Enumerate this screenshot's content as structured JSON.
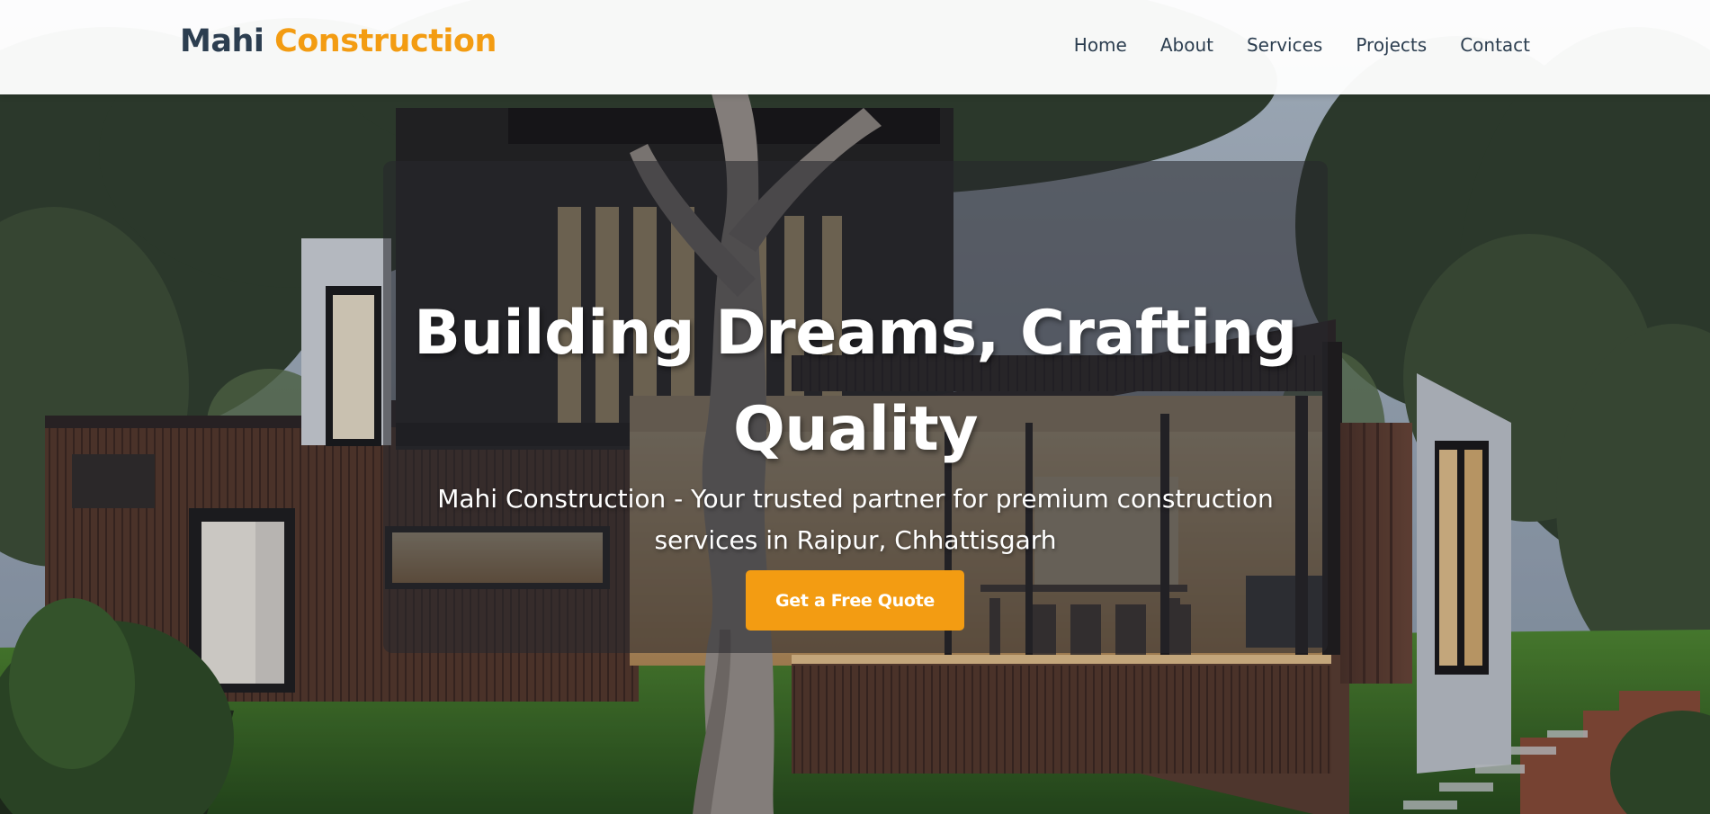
{
  "header": {
    "logo": {
      "part1": "Mahi",
      "part2": "Construction"
    },
    "nav": [
      {
        "label": "Home"
      },
      {
        "label": "About"
      },
      {
        "label": "Services"
      },
      {
        "label": "Projects"
      },
      {
        "label": "Contact"
      }
    ]
  },
  "hero": {
    "title": "Building Dreams, Crafting Quality",
    "subtitle": "Mahi Construction - Your trusted partner for premium construction services in Raipur, Chhattisgarh",
    "cta_label": "Get a Free Quote"
  },
  "colors": {
    "brand_dark": "#2c3e50",
    "accent": "#f39c12",
    "text_light": "#ffffff"
  }
}
